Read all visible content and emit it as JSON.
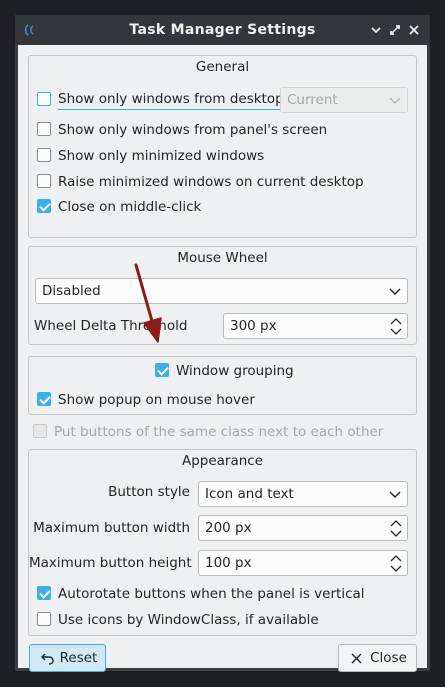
{
  "window": {
    "title": "Task Manager Settings",
    "icons": {
      "app": "app-icon",
      "minimize": "minimize-icon",
      "maximize": "maximize-icon",
      "close": "close-icon"
    }
  },
  "general": {
    "title": "General",
    "show_only_desktop": {
      "label": "Show only windows from desktop",
      "checked": false
    },
    "desktop_combo": {
      "value": "Current"
    },
    "show_only_panel_screen": {
      "label": "Show only windows from panel's screen",
      "checked": false
    },
    "show_only_minimized": {
      "label": "Show only minimized windows",
      "checked": false
    },
    "raise_minimized": {
      "label": "Raise minimized windows on current desktop",
      "checked": false
    },
    "close_middle_click": {
      "label": "Close on middle-click",
      "checked": true
    }
  },
  "mouse_wheel": {
    "title": "Mouse Wheel",
    "mode": "Disabled",
    "delta_label": "Wheel Delta Threshold",
    "delta_value": "300 px"
  },
  "grouping": {
    "window_grouping": {
      "label": "Window grouping",
      "checked": true
    },
    "show_popup": {
      "label": "Show popup on mouse hover",
      "checked": true
    }
  },
  "same_class": {
    "label": "Put buttons of the same class next to each other",
    "checked": false
  },
  "appearance": {
    "title": "Appearance",
    "button_style_label": "Button style",
    "button_style_value": "Icon and text",
    "max_width_label": "Maximum button width",
    "max_width_value": "200 px",
    "max_height_label": "Maximum button height",
    "max_height_value": "100 px",
    "autorotate": {
      "label": "Autorotate buttons when the panel is vertical",
      "checked": true
    },
    "use_icons": {
      "label": "Use icons by WindowClass, if available",
      "checked": false
    }
  },
  "buttons": {
    "reset": "Reset",
    "close": "Close"
  },
  "colors": {
    "accent": "#3daee9",
    "annotation_arrow": "#8b1a1a",
    "titlebar": "#33373c",
    "background": "#eff0f1"
  }
}
